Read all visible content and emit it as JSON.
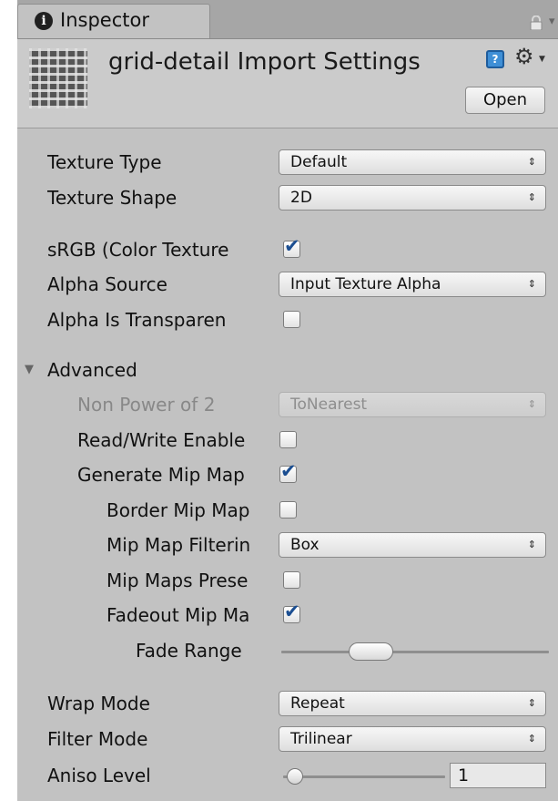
{
  "tab": {
    "title": "Inspector"
  },
  "header": {
    "title": "grid-detail Import Settings",
    "open_label": "Open"
  },
  "properties": {
    "texture_type": {
      "label": "Texture Type",
      "value": "Default"
    },
    "texture_shape": {
      "label": "Texture Shape",
      "value": "2D"
    },
    "srgb": {
      "label": "sRGB (Color Texture",
      "checked": true
    },
    "alpha_source": {
      "label": "Alpha Source",
      "value": "Input Texture Alpha"
    },
    "alpha_is_transparency": {
      "label": "Alpha Is Transparen",
      "checked": false
    }
  },
  "advanced": {
    "label": "Advanced",
    "expanded": true,
    "non_power_of_2": {
      "label": "Non Power of 2",
      "value": "ToNearest",
      "enabled": false
    },
    "read_write": {
      "label": "Read/Write Enable",
      "checked": false
    },
    "generate_mip_maps": {
      "label": "Generate Mip Map",
      "checked": true
    },
    "border_mip_maps": {
      "label": "Border Mip Map",
      "checked": false
    },
    "mip_map_filtering": {
      "label": "Mip Map Filterin",
      "value": "Box"
    },
    "mip_maps_preserve": {
      "label": "Mip Maps Prese",
      "checked": false
    },
    "fadeout_mip_maps": {
      "label": "Fadeout Mip Ma",
      "checked": true
    },
    "fade_range": {
      "label": "Fade Range",
      "min_fraction": 0.25,
      "max_fraction": 0.42
    }
  },
  "wrap": {
    "wrap_mode": {
      "label": "Wrap Mode",
      "value": "Repeat"
    },
    "filter_mode": {
      "label": "Filter Mode",
      "value": "Trilinear"
    },
    "aniso_level": {
      "label": "Aniso Level",
      "value": "1",
      "fraction": 0.0
    }
  },
  "icons": {
    "tab": "info-icon",
    "lock": "lock-icon",
    "help": "help-book-icon",
    "settings": "gear-icon",
    "foldout": "triangle-down-icon"
  },
  "colors": {
    "panel": "#c2c2c2",
    "checkmark": "#1b4e91",
    "tabbar": "#a6a6a6"
  }
}
